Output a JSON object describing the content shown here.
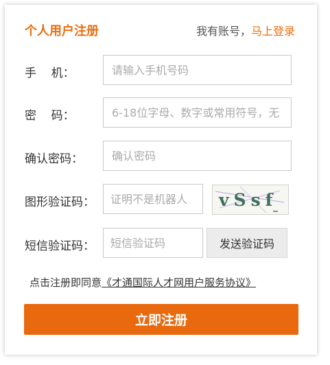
{
  "header": {
    "title": "个人用户注册",
    "have_account": "我有账号，",
    "login_link": "马上登录"
  },
  "form": {
    "phone": {
      "label": "手    机：",
      "placeholder": "请输入手机号码"
    },
    "password": {
      "label": "密    码：",
      "placeholder": "6-18位字母、数字或常用符号，无"
    },
    "confirm": {
      "label": "确认密码：",
      "placeholder": "确认密码"
    },
    "captcha": {
      "label": "图形验证码：",
      "placeholder": "证明不是机器人",
      "image_text": "vSsf"
    },
    "sms": {
      "label": "短信验证码：",
      "placeholder": "短信验证码",
      "send_button": "发送验证码"
    }
  },
  "agreement": {
    "prefix": "点击注册即同意",
    "link": "《才通国际人才网用户服务协议》"
  },
  "submit_label": "立即注册",
  "colors": {
    "accent": "#e8690e"
  }
}
